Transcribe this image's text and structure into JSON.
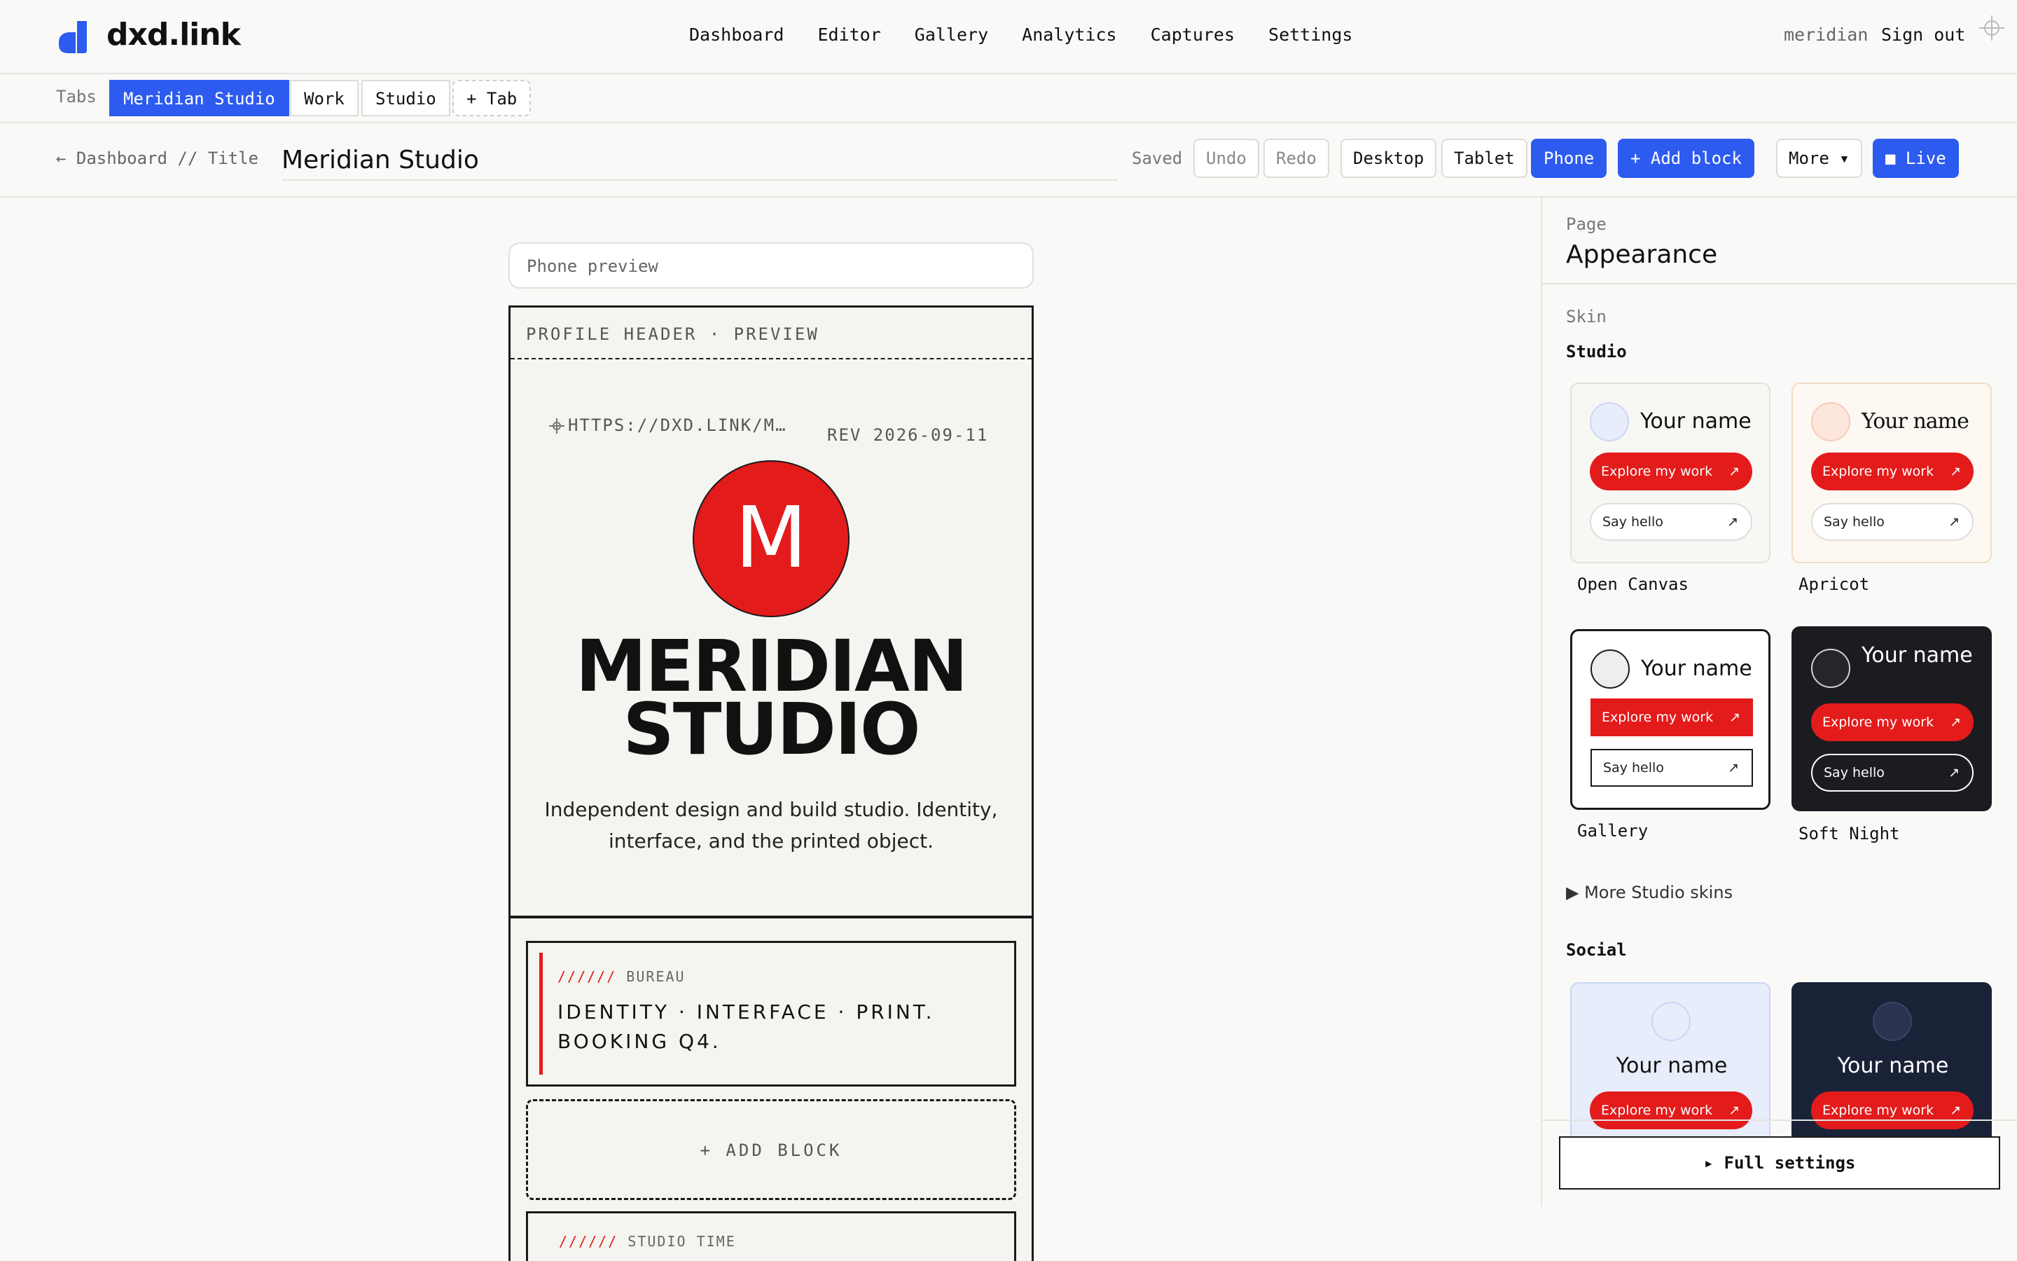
{
  "app": {
    "logo_text": "dxd.link",
    "nav": [
      "Dashboard",
      "Editor",
      "Gallery",
      "Analytics",
      "Captures",
      "Settings"
    ],
    "user": "meridian",
    "sign_out": "Sign out"
  },
  "tabs": {
    "label": "Tabs",
    "items": [
      "Meridian Studio",
      "Work",
      "Studio"
    ],
    "add": "+ Tab"
  },
  "titlebar": {
    "back": "← Dashboard // Title",
    "title": "Meridian Studio",
    "saved": "Saved",
    "undo": "Undo",
    "redo": "Redo",
    "desktop": "Desktop",
    "tablet": "Tablet",
    "phone": "Phone",
    "add_block": "+ Add block",
    "more": "More ▾",
    "live": "■ Live"
  },
  "preview": {
    "label": "Phone preview",
    "header_label": "PROFILE HEADER · PREVIEW",
    "url": "HTTPS://DXD.LINK/MERIDIAN",
    "rev": "REV 2026-09-11",
    "avatar_letter": "M",
    "name_line1": "MERIDIAN",
    "name_line2": "STUDIO",
    "bio": "Independent design and build studio. Identity, interface, and the printed object.",
    "bureau_slashes": "//////",
    "bureau_kicker": "BUREAU",
    "bureau_text": "IDENTITY · INTERFACE · PRINT. BOOKING Q4.",
    "add_block": "+ ADD BLOCK",
    "time_slashes": "//////",
    "time_kicker": "STUDIO TIME"
  },
  "panel": {
    "kicker": "Page",
    "title": "Appearance",
    "skin_label": "Skin",
    "studio_label": "Studio",
    "sample_name": "Your name",
    "sample_btn1": "Explore my work",
    "sample_btn2": "Say hello",
    "arrow": "↗",
    "skins": [
      "Open Canvas",
      "Apricot",
      "Gallery",
      "Soft Night"
    ],
    "more_skins": "▶ More Studio skins",
    "social_label": "Social",
    "full_settings": "▸ Full settings"
  },
  "colors": {
    "accent_blue": "#2d5bf0",
    "brand_red": "#e31b1b",
    "dark": "#1a1a1a"
  }
}
